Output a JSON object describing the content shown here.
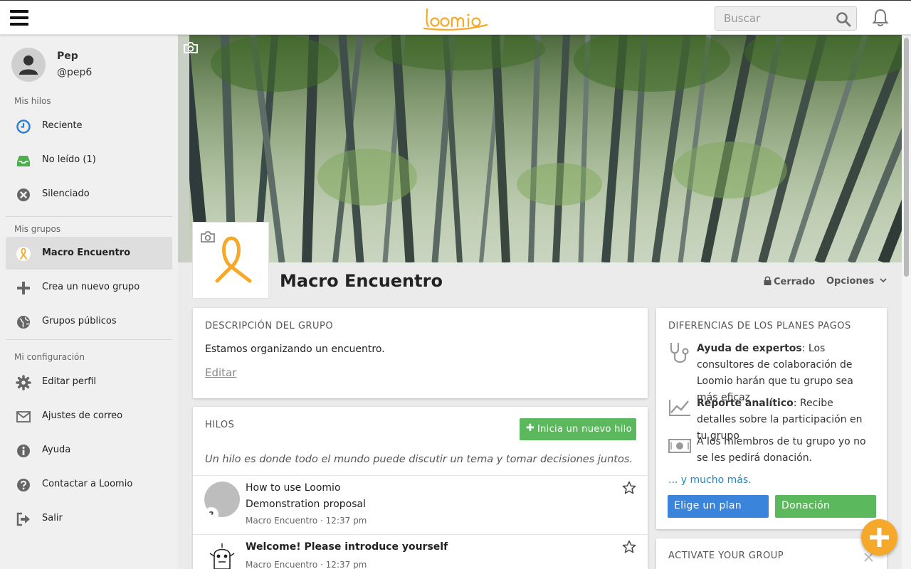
{
  "header": {
    "logo_text": "loomio",
    "search_placeholder": "Buscar"
  },
  "sidebar": {
    "user": {
      "name": "Pep",
      "handle": "@pep6"
    },
    "sections": {
      "threads": "Mis hilos",
      "groups": "Mis grupos",
      "settings": "Mi configuración"
    },
    "thread_items": [
      {
        "label": "Reciente",
        "icon": "clock-icon"
      },
      {
        "label": "No leído (1)",
        "icon": "inbox-icon"
      },
      {
        "label": "Silenciado",
        "icon": "mute-icon"
      }
    ],
    "group_items": [
      {
        "label": "Macro Encuentro",
        "icon": "group-logo-icon"
      },
      {
        "label": "Crea un nuevo grupo",
        "icon": "plus-icon"
      },
      {
        "label": "Grupos públicos",
        "icon": "globe-icon"
      }
    ],
    "settings_items": [
      {
        "label": "Editar perfil",
        "icon": "gear-icon"
      },
      {
        "label": "Ajustes de correo",
        "icon": "envelope-icon"
      },
      {
        "label": "Ayuda",
        "icon": "info-icon"
      },
      {
        "label": "Contactar a Loomio",
        "icon": "question-icon"
      },
      {
        "label": "Salir",
        "icon": "sign-out-icon"
      }
    ]
  },
  "group": {
    "name": "Macro Encuentro",
    "privacy": "Cerrado",
    "options": "Opciones"
  },
  "description": {
    "title": "DESCRIPCIÓN DEL GRUPO",
    "text": "Estamos organizando un encuentro.",
    "edit": "Editar"
  },
  "threads": {
    "title": "HILOS",
    "new_thread": "Inicia un nuevo hilo",
    "help": "Un hilo es donde todo el mundo puede discutir un tema y tomar decisiones juntos.",
    "items": [
      {
        "title": "How to use Loomio",
        "subtitle": "Demonstration proposal",
        "meta": "Macro Encuentro · 12:37 pm"
      },
      {
        "title": "Welcome! Please introduce yourself",
        "meta": "Macro Encuentro · 12:37 pm"
      }
    ]
  },
  "plans": {
    "title": "DIFERENCIAS DE LOS PLANES PAGOS",
    "features": [
      {
        "bold": "Ayuda de expertos",
        "text": ": Los consultores de colaboración de Loomio harán que tu grupo sea más eficaz",
        "icon": "stethoscope-icon"
      },
      {
        "bold": "Reporte analítico",
        "text": ": Recibe detalles sobre la participación en tu grupo",
        "icon": "chart-icon"
      },
      {
        "bold": "",
        "text": "A los miembros de tu grupo yo no se les pedirá donación.",
        "icon": "money-icon"
      }
    ],
    "more": "... y mucho más.",
    "choose_plan": "Elige un plan",
    "donation": "Donación"
  },
  "activate": {
    "title": "ACTIVATE YOUR GROUP"
  },
  "colors": {
    "brand": "#f6a82a",
    "primary_button": "#3b84db",
    "success": "#5cb85c",
    "link": "#1e88c9"
  }
}
